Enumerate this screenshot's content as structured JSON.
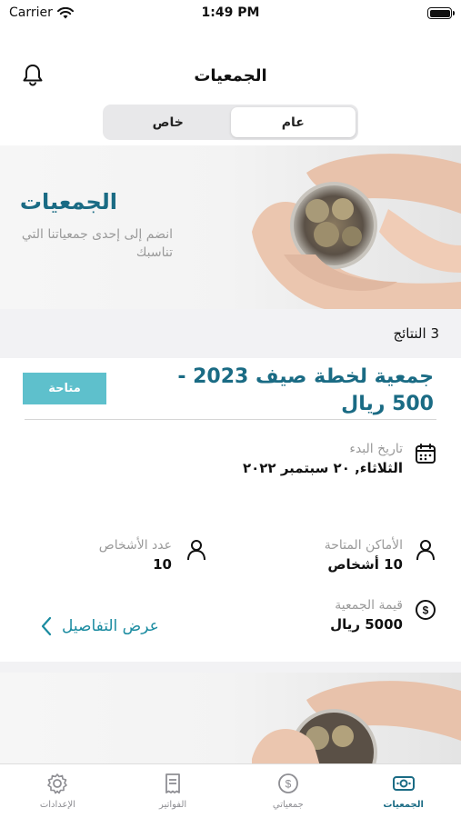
{
  "status_bar": {
    "carrier": "Carrier",
    "time": "1:49 PM"
  },
  "header": {
    "title": "الجمعيات",
    "bell_icon": "bell-icon"
  },
  "segmented": {
    "public_label": "عام",
    "private_label": "خاص",
    "selected": "عام"
  },
  "banner": {
    "title": "الجمعيات",
    "subtitle": "انضم إلى إحدى جمعياتنا التي تناسبك"
  },
  "results": {
    "count_text": "3 النتائج"
  },
  "card": {
    "title": "جمعية لخطة صيف 2023 - 500 ريال",
    "status": "متاحة",
    "start_date_label": "تاريخ البدء",
    "start_date_value": "الثلاثاء, ٢٠ سبتمبر ٢٠٢٢",
    "available_slots_label": "الأماكن المتاحة",
    "available_slots_value": "10 أشخاص",
    "people_count_label": "عدد الأشخاص",
    "people_count_value": "10",
    "value_label": "قيمة الجمعية",
    "value_value": "5000 ريال",
    "details_link": "عرض التفاصيل"
  },
  "tabbar": {
    "items": [
      {
        "label": "الإعدادات",
        "icon": "gear-icon"
      },
      {
        "label": "الفواتير",
        "icon": "receipt-icon"
      },
      {
        "label": "جمعياتي",
        "icon": "coin-icon"
      },
      {
        "label": "الجمعيات",
        "icon": "cash-icon"
      }
    ],
    "active": "الجمعيات"
  },
  "colors": {
    "accent": "#1a6b84",
    "link": "#1a8ba0",
    "badge": "#5ec0cc",
    "muted": "#9a9a9a"
  }
}
